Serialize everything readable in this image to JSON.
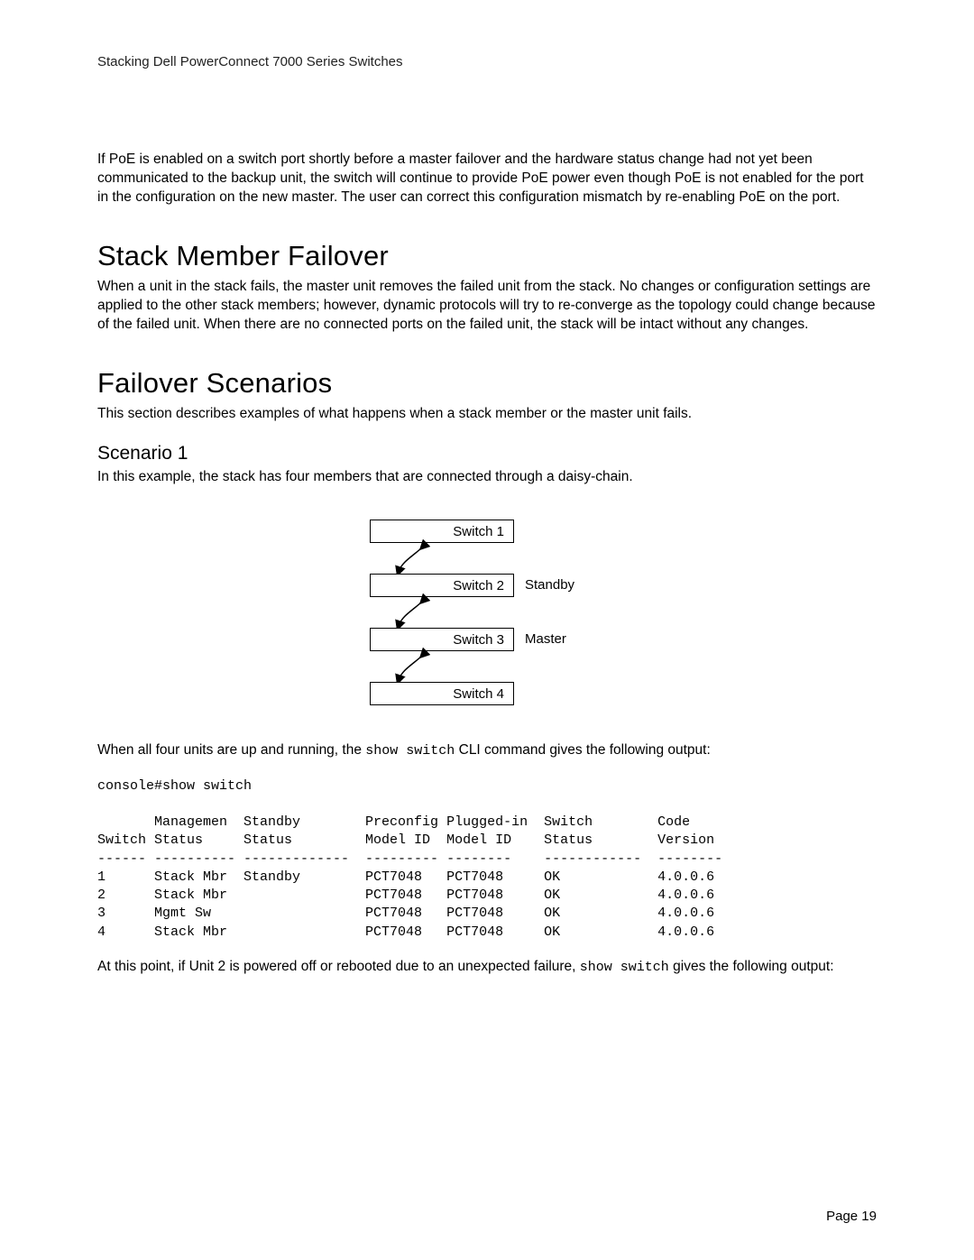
{
  "header": {
    "running_title": "Stacking Dell PowerConnect 7000 Series Switches"
  },
  "intro_paragraph": "If PoE is enabled on a switch port shortly before a master failover and the hardware status change had not yet been communicated to the backup unit, the switch will continue to provide PoE power even though PoE is not enabled for the port in the configuration on the new master. The user can correct this configuration mismatch by re-enabling PoE on the port.",
  "sections": {
    "stack_member_failover": {
      "title": "Stack Member Failover",
      "body": "When a unit in the stack fails, the master unit removes the failed unit from the stack. No changes or configuration settings are applied to the other stack members; however, dynamic protocols will try to re-converge as the topology could change because of the failed unit. When there are no connected ports on the failed unit, the stack will be intact without any changes."
    },
    "failover_scenarios": {
      "title": "Failover Scenarios",
      "intro": "This section describes examples of what happens when a stack member or the master unit fails.",
      "scenario1": {
        "title": "Scenario 1",
        "intro": "In this example, the stack has four members that are connected through a daisy-chain.",
        "diagram": {
          "switches": [
            {
              "label": "Switch 1",
              "role": ""
            },
            {
              "label": "Switch 2",
              "role": "Standby"
            },
            {
              "label": "Switch 3",
              "role": "Master"
            },
            {
              "label": "Switch 4",
              "role": ""
            }
          ]
        },
        "after_diagram_pre": "When all four units are up and running, the ",
        "after_diagram_code": "show switch",
        "after_diagram_post": " CLI command gives the following output:",
        "cli_output": "console#show switch\n\n       Managemen  Standby        Preconfig Plugged-in  Switch        Code\nSwitch Status     Status         Model ID  Model ID    Status        Version\n------ ---------- -------------  --------- --------    ------------  --------\n1      Stack Mbr  Standby        PCT7048   PCT7048     OK            4.0.0.6\n2      Stack Mbr                 PCT7048   PCT7048     OK            4.0.0.6\n3      Mgmt Sw                   PCT7048   PCT7048     OK            4.0.0.6\n4      Stack Mbr                 PCT7048   PCT7048     OK            4.0.0.6",
        "after_cli_pre": "At this point, if Unit 2 is powered off or rebooted due to an unexpected failure, ",
        "after_cli_code": "show switch",
        "after_cli_post": " gives the following output:"
      }
    }
  },
  "footer": {
    "page_label": "Page 19"
  }
}
